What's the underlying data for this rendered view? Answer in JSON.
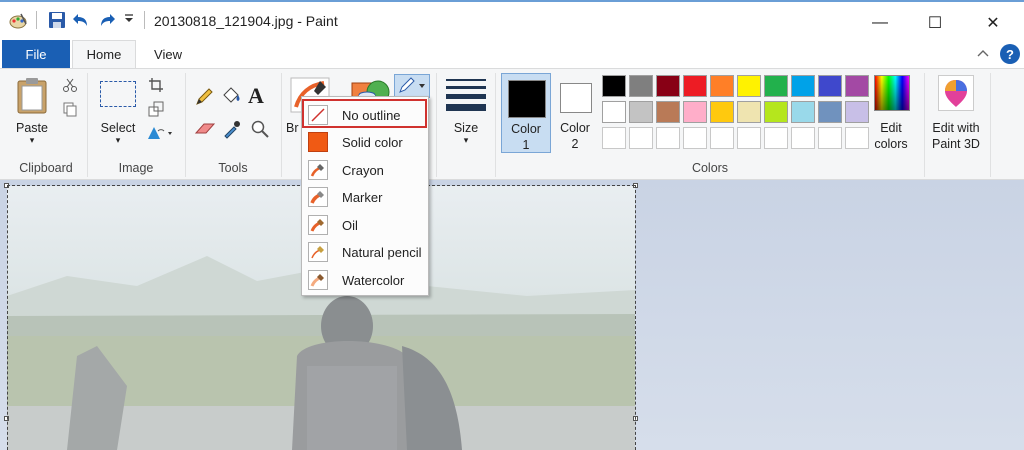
{
  "window": {
    "title": "20130818_121904.jpg - Paint",
    "minimize_glyph": "—",
    "maximize_glyph": "☐",
    "close_glyph": "✕"
  },
  "tabs": {
    "file": "File",
    "home": "Home",
    "view": "View"
  },
  "ribbon": {
    "clipboard": {
      "paste": "Paste",
      "group_label": "Clipboard"
    },
    "image": {
      "select": "Select",
      "group_label": "Image"
    },
    "tools": {
      "text_glyph": "A",
      "group_label": "Tools"
    },
    "brushes": {
      "label": "Br"
    },
    "size": {
      "label": "Size"
    },
    "colors": {
      "color1_label": "Color",
      "color1_num": "1",
      "color2_label": "Color",
      "color2_num": "2",
      "edit_label": "Edit",
      "edit_label2": "colors",
      "group_label": "Colors",
      "row1": [
        "#000000",
        "#7f7f7f",
        "#880015",
        "#ed1c24",
        "#ff7f27",
        "#fff200",
        "#22b14c",
        "#00a2e8",
        "#3f48cc",
        "#a349a4"
      ],
      "row2": [
        "#ffffff",
        "#c3c3c3",
        "#b97a57",
        "#ffaec9",
        "#ffc90e",
        "#efe4b0",
        "#b5e61d",
        "#99d9ea",
        "#7092be",
        "#c8bfe7"
      ]
    },
    "paint3d": {
      "label": "Edit with",
      "label2": "Paint 3D"
    }
  },
  "outline_menu": {
    "items": [
      {
        "label": "No outline"
      },
      {
        "label": "Solid color"
      },
      {
        "label": "Crayon"
      },
      {
        "label": "Marker"
      },
      {
        "label": "Oil"
      },
      {
        "label": "Natural pencil"
      },
      {
        "label": "Watercolor"
      }
    ],
    "selected": "No outline"
  }
}
